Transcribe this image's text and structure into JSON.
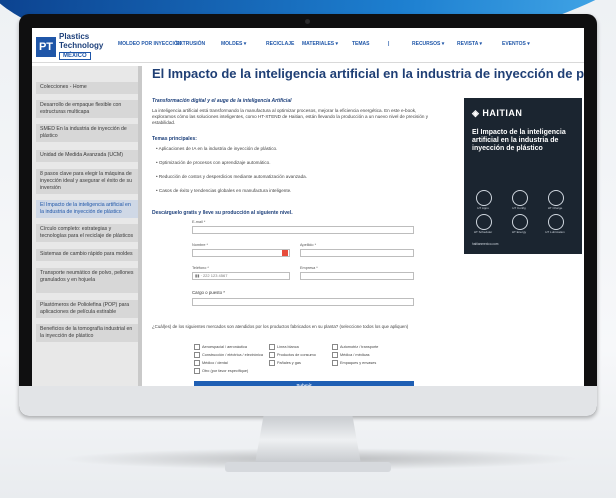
{
  "nav": {
    "logo_mark": "PT",
    "logo_line1": "Plastics",
    "logo_line2": "Technology",
    "logo_country": "MÉXICO",
    "items": [
      "MOLDEO POR INYECCIÓN",
      "EXTRUSIÓN",
      "MOLDES ▾",
      "RECICLAJE",
      "MATERIALES ▾",
      "TEMAS",
      "|",
      "RECURSOS ▾",
      "REVISTA ▾",
      "EVENTOS ▾"
    ]
  },
  "sidebar": {
    "items": [
      "Colecciones - Home",
      "Desarrollo de empaque flexible con estructuras multicapa",
      "SMED En la industria de inyección de plástico",
      "Unidad de Medida Avanzada (UCM)",
      "8 pasos clave para elegir la máquina de inyección ideal y asegurar el éxito de su inversión",
      "El Impacto de la inteligencia artificial en la industria de inyección de plástico",
      "Círculo completo: estrategias y tecnologías para el reciclaje de plásticos",
      "Sistemas de cambio rápido para moldes",
      "Transporte neumático de polvo, pellones granulados y en hojuela",
      "Plastómeros de Poliolefina (POP) para aplicaciones de película estirable",
      "Beneficios de la tomografía industrial en la inyección de plástico"
    ],
    "active_index": 5
  },
  "main": {
    "title": "El Impacto de la inteligencia artificial en la industria de inyección de plástico",
    "intro_title": "Transformación digital y el auge de la inteligencia Artificial",
    "intro_text": "La inteligencia artificial está transformando la manufactura al optimizar procesos, mejorar la eficiencia energética. En este e-book, exploramos cómo las soluciones inteligentes, como HT-XTEND de Haitian, están llevando la producción a un nuevo nivel de precisión y estabilidad.",
    "temas_title": "Temas principales:",
    "bullets": [
      "Aplicaciones de IA en la industria de inyección de plástico.",
      "Optimización de procesos con aprendizaje automático.",
      "Reducción de costos y desperdicios mediante automatización avanzada.",
      "Casos de éxito y tendencias globales en manufactura inteligente."
    ],
    "cta": "Descárguelo gratis y lleve su producción al siguiente nivel.",
    "form": {
      "email_label": "E-mail *",
      "nombre_label": "Nombre *",
      "apellido_label": "Apellido *",
      "telefono_label": "Teléfono *",
      "telefono_value": "▮▮ · 222 123 4567",
      "empresa_label": "Empresa *",
      "cargo_label": "Cargo o puesto *",
      "question": "¿Cuál(es) de los siguientes mercados son atendidos por los productos fabricados en su planta? (seleccione todos los que apliquen)",
      "options": [
        "Aeroespacial / aeronáutica",
        "Línea blanca",
        "Automotriz / transporte",
        "Construcción / eléctrica / electrónica",
        "Productos de consumo",
        "Médica / médicas",
        "Médico / dental",
        "Pañales y gas",
        "Empaques y envases",
        "Otro (por favor especifique)"
      ],
      "submit": "Submit"
    }
  },
  "ebook": {
    "brand": "HAITIAN",
    "title": "El Impacto de la inteligencia artificial en la industria de inyección de plástico",
    "captions": [
      "HT Apps",
      "HT Config",
      "HT Charge",
      "HT Scheduler",
      "HT Energy",
      "HT Lubrication"
    ],
    "url": "haitianmexico.com"
  }
}
